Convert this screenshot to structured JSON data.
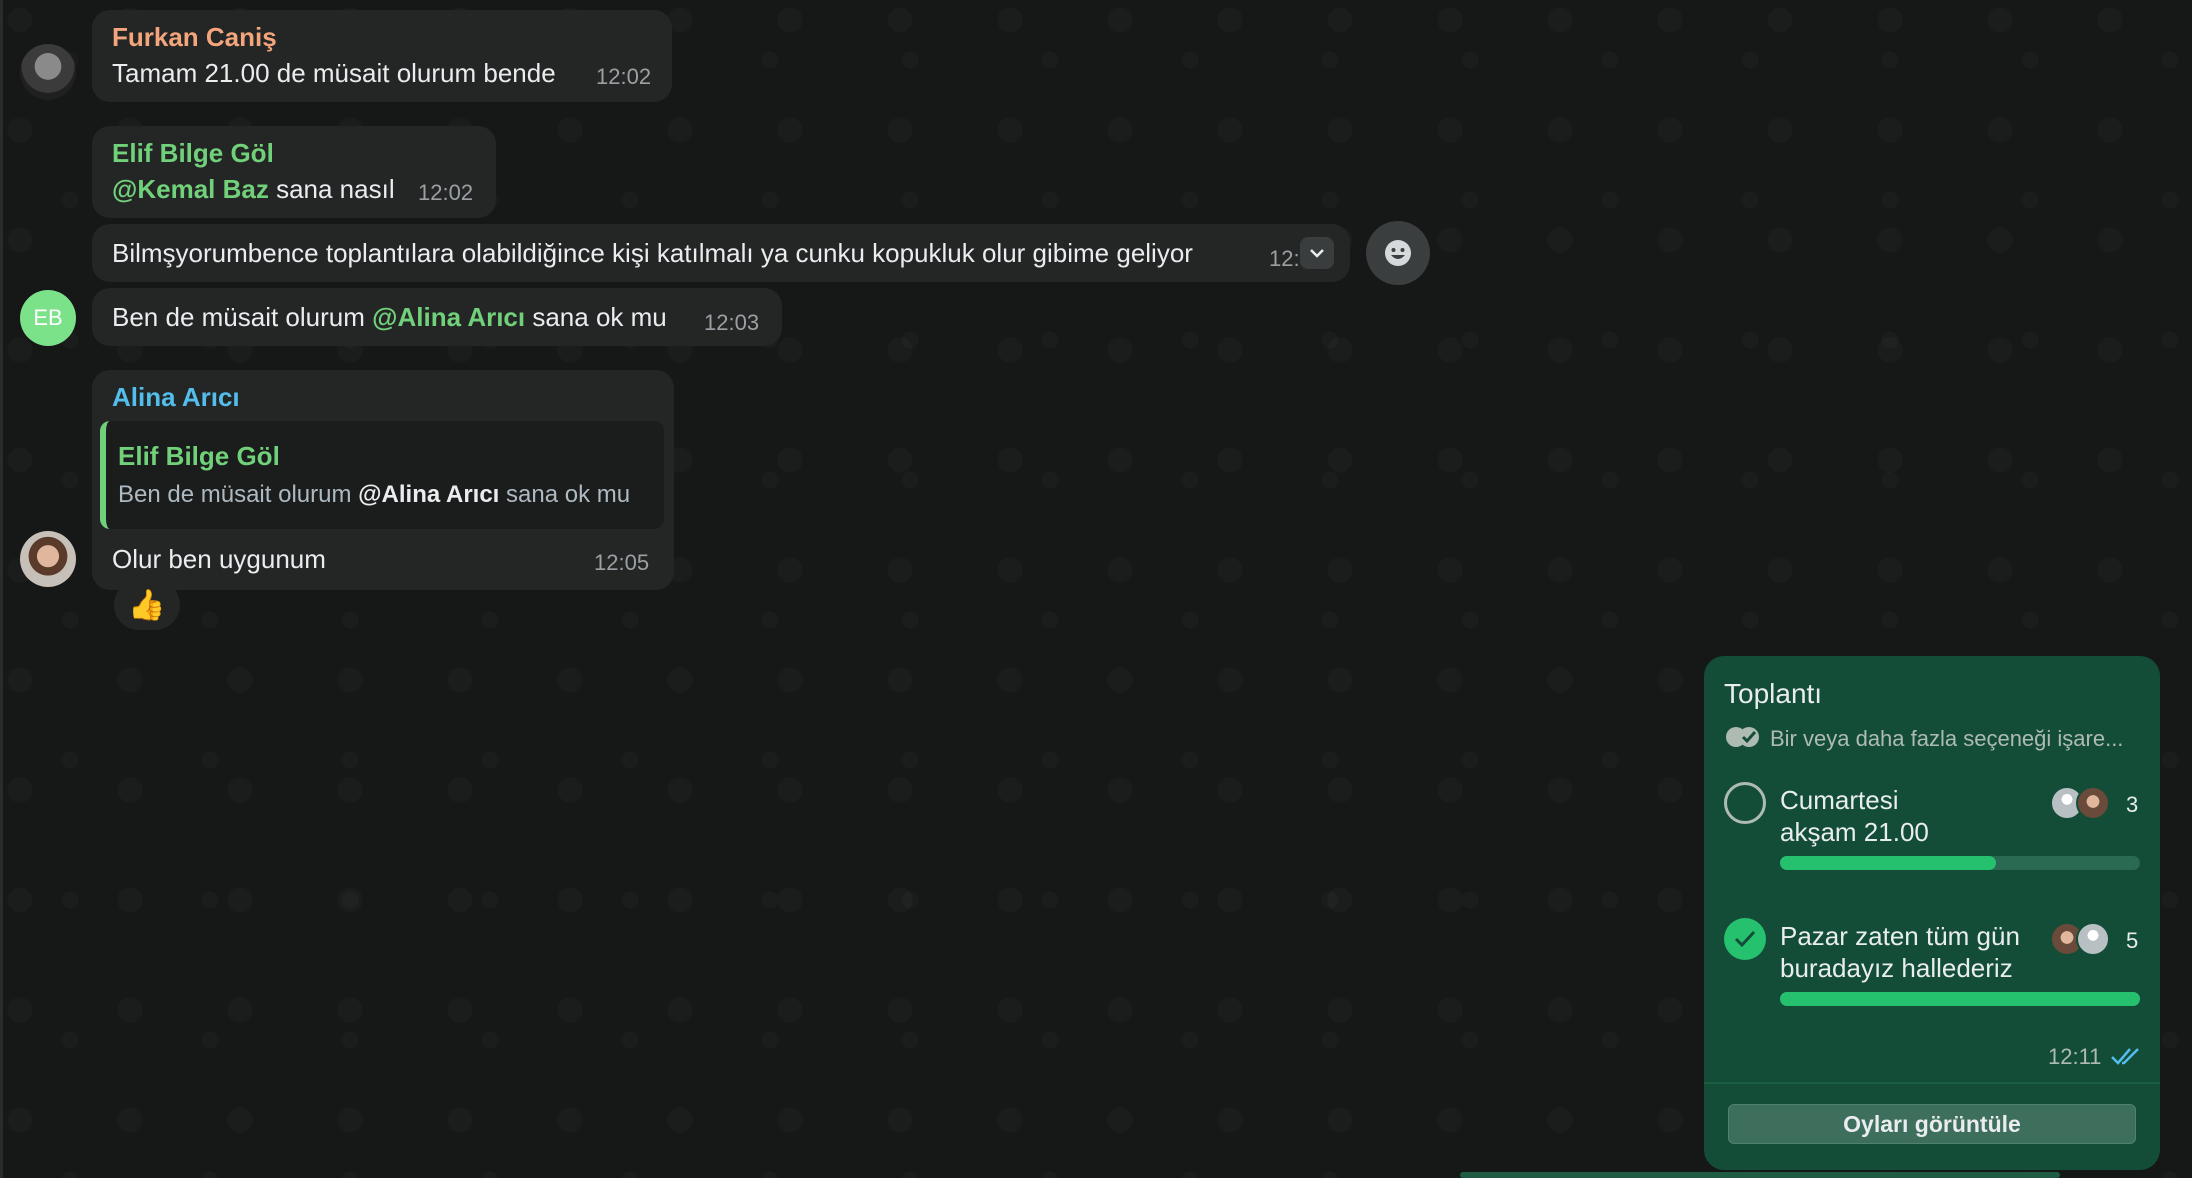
{
  "messages": [
    {
      "sender": "Furkan Caniş",
      "text": "Tamam 21.00 de müsait olurum bende",
      "time": "12:02"
    },
    {
      "sender": "Elif Bilge Göl",
      "mention": "@Kemal Baz",
      "text": " sana nasıl",
      "time": "12:02"
    },
    {
      "text": "Bilmşyorumbence toplantılara olabildiğince kişi katılmalı ya cunku kopukluk olur gibime geliyor",
      "time": "12:"
    },
    {
      "avatar_initials": "EB",
      "text_before": "Ben de müsait olurum ",
      "mention": "@Alina Arıcı",
      "text_after": " sana ok mu",
      "time": "12:03"
    },
    {
      "sender": "Alina Arıcı",
      "quote": {
        "sender": "Elif Bilge Göl",
        "text_before": "Ben de müsait olurum ",
        "mention": "@Alina Arıcı",
        "text_after": " sana ok mu"
      },
      "text": "Olur ben uygunum",
      "time": "12:05",
      "reaction": "👍"
    }
  ],
  "poll": {
    "title": "Toplantı",
    "subtitle": "Bir veya daha fazla seçeneği işare...",
    "options": [
      {
        "line1": "Cumartesi",
        "line2": "akşam 21.00",
        "votes": "3",
        "fraction": 0.6,
        "selected": false
      },
      {
        "line1": "Pazar zaten tüm gün",
        "line2": "buradayız hallederiz",
        "votes": "5",
        "fraction": 1.0,
        "selected": true
      }
    ],
    "time": "12:11",
    "view_votes_label": "Oyları görüntüle"
  },
  "colors": {
    "furkan": "#f5a57b",
    "elif": "#71d17a",
    "alina": "#53bdeb",
    "poll_bg": "#134d37",
    "poll_bar": "#25c16f"
  },
  "icons": [
    "chevron-down-icon",
    "emoji-reaction-icon",
    "double-check-icon",
    "checkmark-icon",
    "thumbs-up-icon"
  ]
}
